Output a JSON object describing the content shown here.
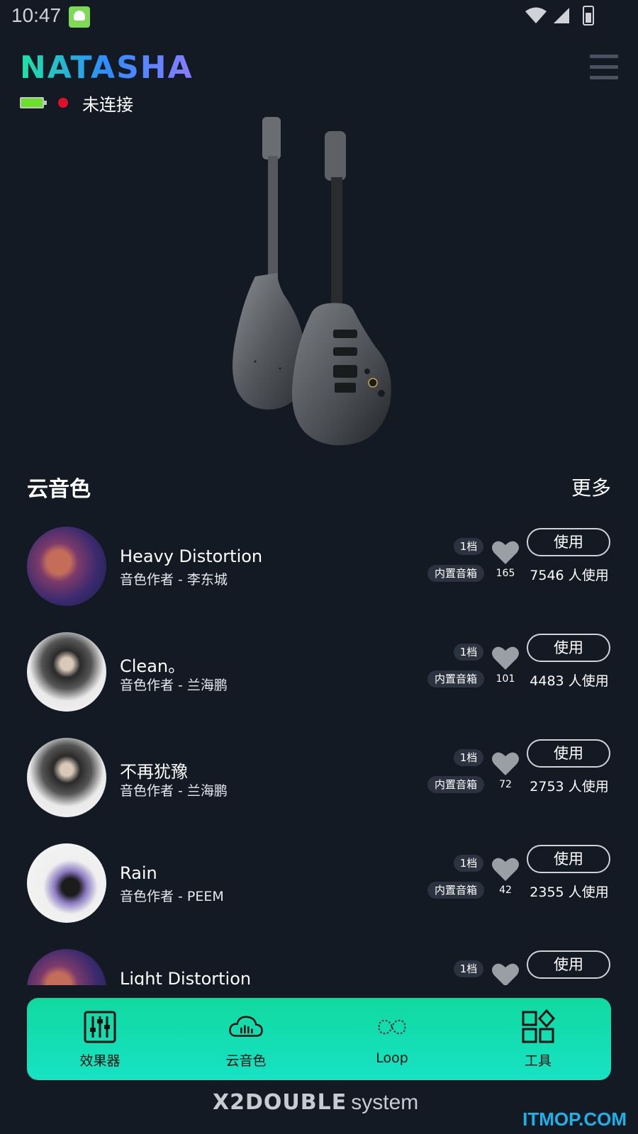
{
  "status_bar": {
    "time": "10:47"
  },
  "header": {
    "logo": "NATASHA",
    "connection_status": "未连接"
  },
  "section": {
    "title": "云音色",
    "more": "更多"
  },
  "presets": [
    {
      "title": "Heavy Distortion",
      "author": "音色作者 - 李东城",
      "level": "1档",
      "speaker": "内置音箱",
      "likes": "165",
      "use_label": "使用",
      "use_count": "7546 人使用"
    },
    {
      "title": "Clean。",
      "author": "音色作者 - 兰海鹏",
      "level": "1档",
      "speaker": "内置音箱",
      "likes": "101",
      "use_label": "使用",
      "use_count": "4483 人使用"
    },
    {
      "title": "不再犹豫",
      "author": "音色作者 - 兰海鹏",
      "level": "1档",
      "speaker": "内置音箱",
      "likes": "72",
      "use_label": "使用",
      "use_count": "2753 人使用"
    },
    {
      "title": "Rain",
      "author": "音色作者 - PEEM",
      "level": "1档",
      "speaker": "内置音箱",
      "likes": "42",
      "use_label": "使用",
      "use_count": "2355 人使用"
    },
    {
      "title": "Light Distortion",
      "author": "",
      "level": "1档",
      "speaker": "",
      "likes": "",
      "use_label": "使用",
      "use_count": ""
    }
  ],
  "bottom_nav": [
    {
      "label": "效果器",
      "icon": "sliders-icon"
    },
    {
      "label": "云音色",
      "icon": "cloud-icon"
    },
    {
      "label": "Loop",
      "icon": "infinity-icon"
    },
    {
      "label": "工具",
      "icon": "tools-grid-icon"
    }
  ],
  "footer": {
    "brand": "X2DOUBLE",
    "suffix": "system",
    "watermark": "ITMOP.COM"
  },
  "colors": {
    "background": "#141a24",
    "nav_gradient_start": "#10d9a0",
    "nav_gradient_end": "#17e2c4",
    "status_dot": "#e0102a",
    "battery": "#6be02a"
  }
}
